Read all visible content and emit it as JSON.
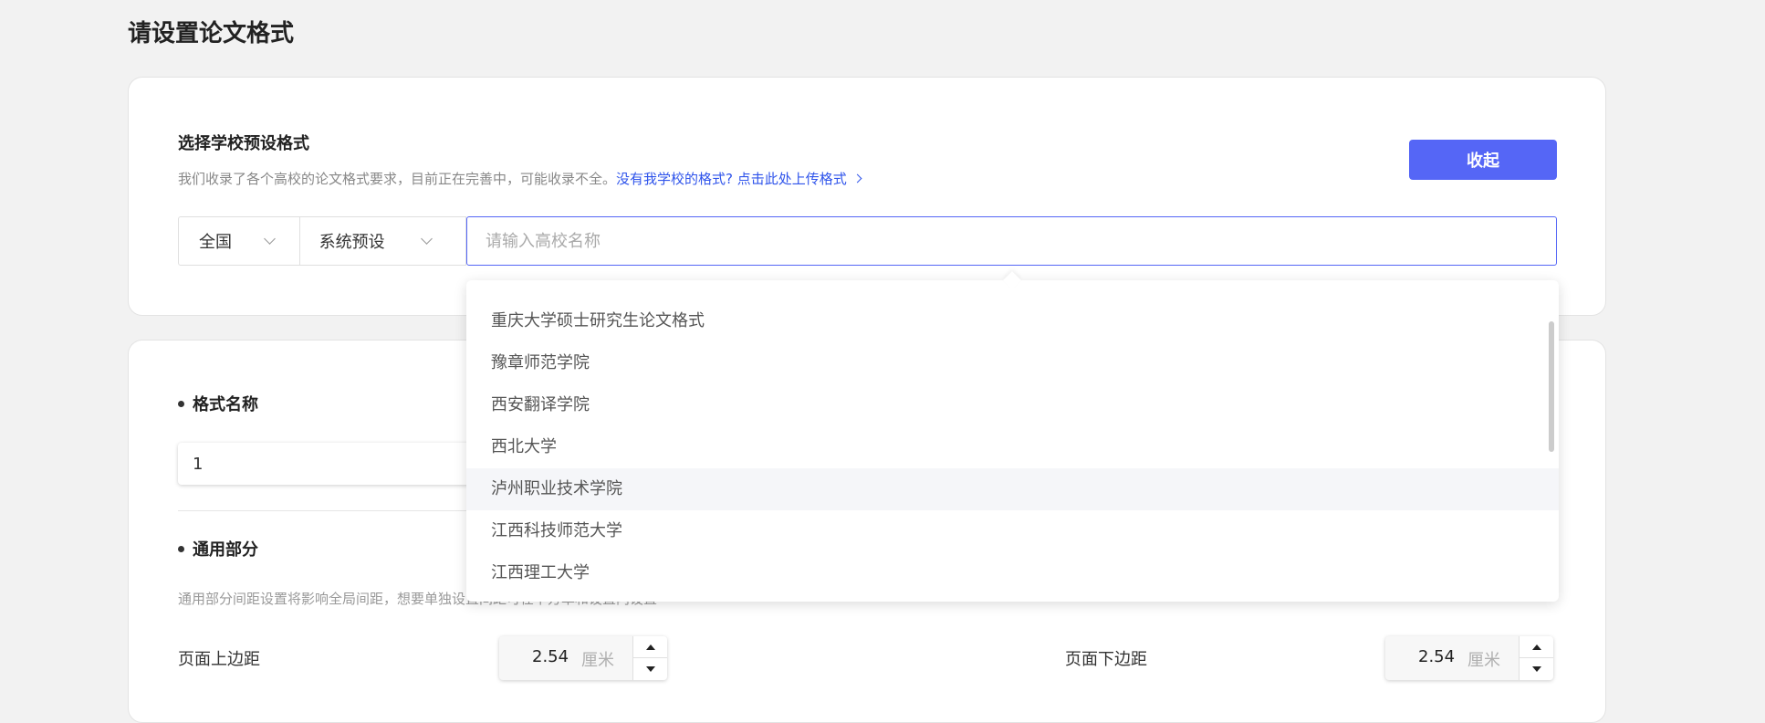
{
  "page": {
    "title": "请设置论文格式"
  },
  "school_preset": {
    "title": "选择学校预设格式",
    "description": "我们收录了各个高校的论文格式要求，目前正在完善中，可能收录不全。",
    "upload_link": "没有我学校的格式? 点击此处上传格式",
    "collapse_button": "收起",
    "region_select": "全国",
    "preset_select": "系统预设",
    "search_placeholder": "请输入高校名称"
  },
  "dropdown": {
    "items": [
      "重庆大学硕士研究生论文格式",
      "豫章师范学院",
      "西安翻译学院",
      "西北大学",
      "泸州职业技术学院",
      "江西科技师范大学",
      "江西理工大学"
    ],
    "hovered_index": 4
  },
  "format": {
    "name_title": "格式名称",
    "name_value": "1",
    "general_title": "通用部分",
    "general_desc": "通用部分间距设置将影响全局间距，想要单独设置间距可在下方单和设置内设置",
    "top_margin_label": "页面上边距",
    "top_margin_value": "2.54",
    "bottom_margin_label": "页面下边距",
    "bottom_margin_value": "2.54",
    "unit": "厘米"
  },
  "colors": {
    "accent": "#5566f6",
    "link": "#2f54eb",
    "background": "#f2f2f2"
  }
}
